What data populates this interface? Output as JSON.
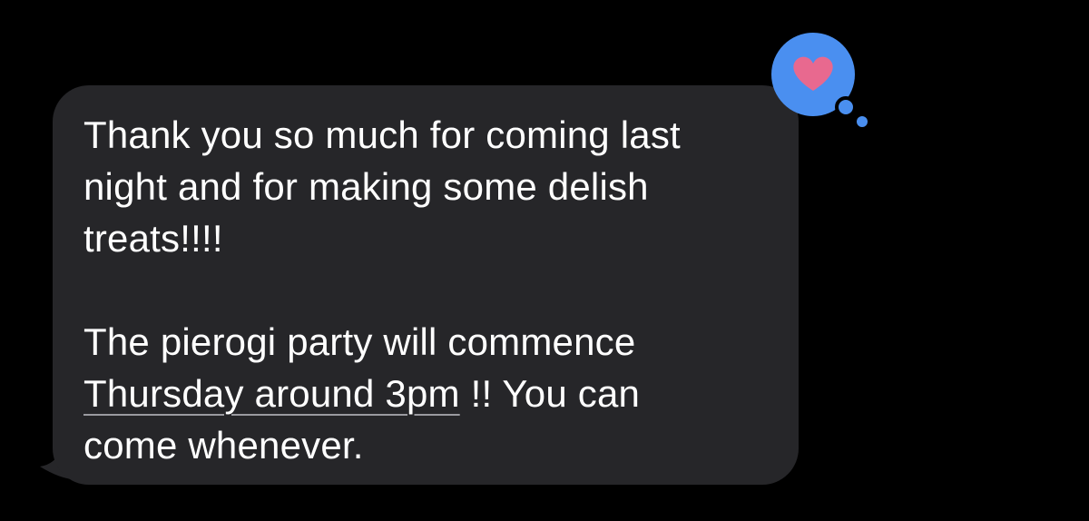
{
  "message": {
    "line_1": "Thank you so much for coming last",
    "line_2": "night and for making some delish",
    "line_3": "treats!!!!",
    "line_4": "The pierogi party will commence",
    "link_text": "Thursday around 3pm",
    "line_5_rest": " !! You can",
    "line_6": "come whenever."
  },
  "tapback": {
    "icon": "heart-icon",
    "bubble_color": "#4a8ff0",
    "heart_color": "#e8698f"
  },
  "colors": {
    "background": "#000000",
    "bubble": "#262629",
    "text": "#ffffff"
  }
}
